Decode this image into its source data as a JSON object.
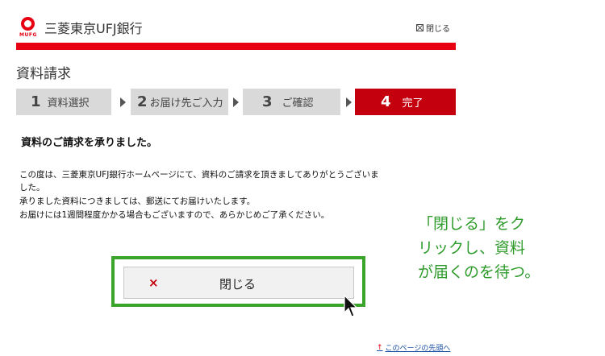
{
  "header": {
    "logo_sub": "MUFG",
    "bank_name": "三菱東京UFJ銀行",
    "close_label": "閉じる"
  },
  "page_title": "資料請求",
  "steps": [
    {
      "num": "1",
      "label": "資料選択"
    },
    {
      "num": "2",
      "label": "お届け先ご入力"
    },
    {
      "num": "3",
      "label": "ご確認"
    },
    {
      "num": "4",
      "label": "完了"
    }
  ],
  "heading": "資料のご請求を承りました。",
  "messages": [
    "この度は、三菱東京UFJ銀行ホームページにて、資料のご請求を頂きましてありがとうございま",
    "した。",
    "承りました資料につきましては、郵送にてお届けいたします。",
    "お届けには1週間程度かかる場合もございますので、あらかじめご了承ください。"
  ],
  "close_button": {
    "icon": "×",
    "label": "閉じる"
  },
  "callout": [
    "「閉じる」をク",
    "リックし、資料",
    "が届くのを待つ。"
  ],
  "top_link": "このページの先頭へ",
  "colors": {
    "brand_red": "#e60012",
    "active_step": "#c4000f",
    "annotation_green": "#3aa42b"
  }
}
